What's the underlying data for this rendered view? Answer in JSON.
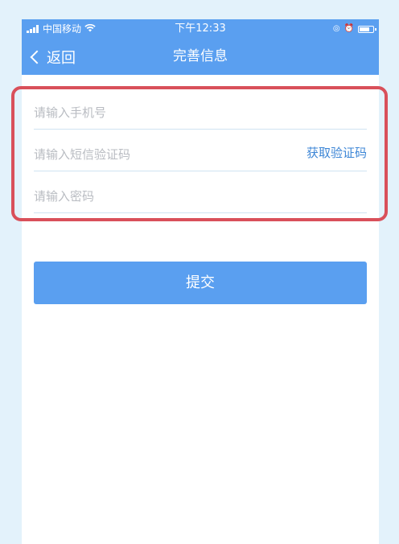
{
  "status_bar": {
    "carrier": "中国移动",
    "time": "下午12:33"
  },
  "nav": {
    "back_label": "返回",
    "title": "完善信息"
  },
  "form": {
    "phone_placeholder": "请输入手机号",
    "sms_code_placeholder": "请输入短信验证码",
    "get_code_label": "获取验证码",
    "password_placeholder": "请输入密码"
  },
  "submit_label": "提交",
  "colors": {
    "primary": "#5a9ff0",
    "link": "#3d86d6",
    "highlight": "#d9505a",
    "background": "#e3f2fb"
  }
}
